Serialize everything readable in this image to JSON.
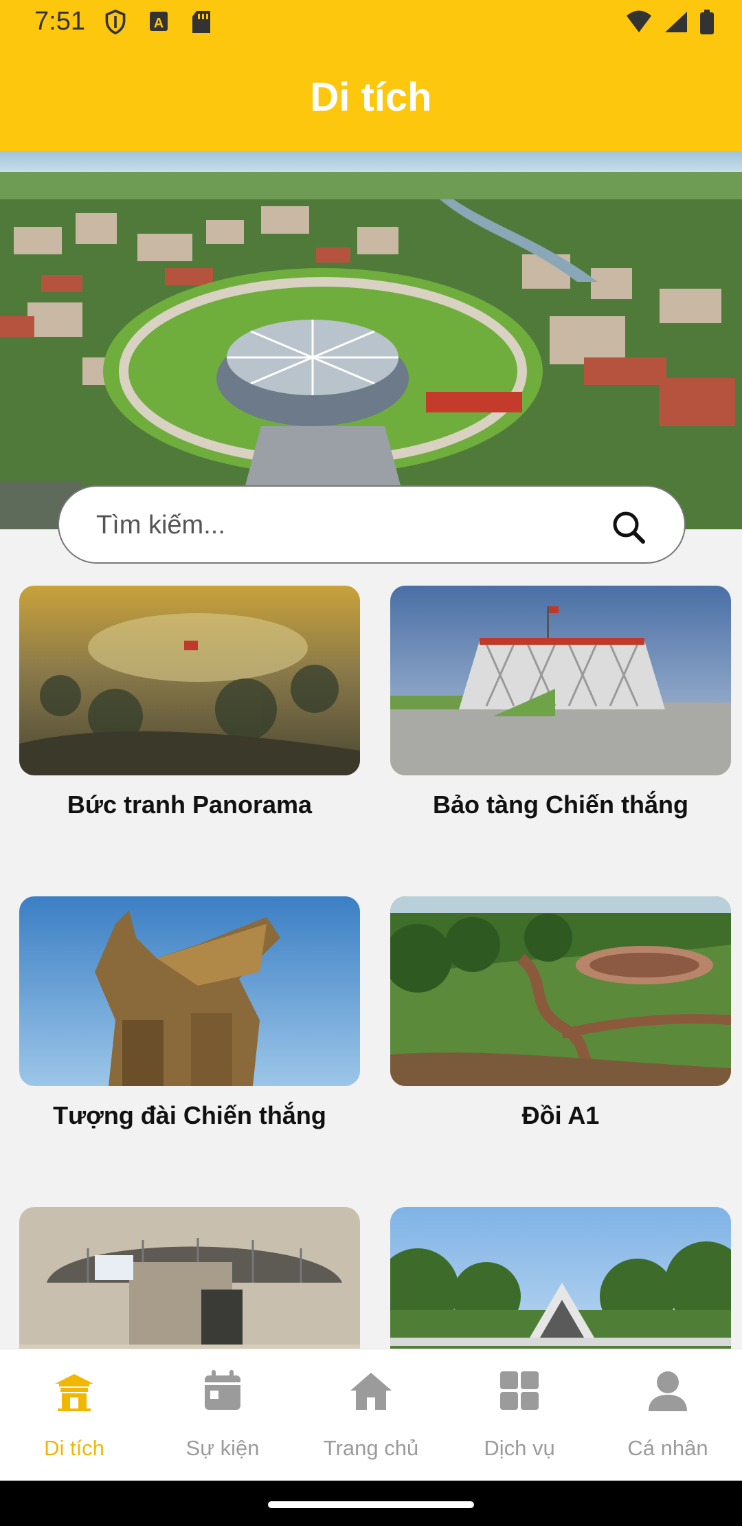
{
  "status_bar": {
    "time": "7:51",
    "left_icons": [
      "shield-icon",
      "a-badge-icon",
      "sd-card-icon"
    ],
    "right_icons": [
      "wifi-icon",
      "signal-icon",
      "battery-icon"
    ]
  },
  "app_bar": {
    "title": "Di tích",
    "background": "#FDC70E"
  },
  "search": {
    "placeholder": "Tìm kiếm...",
    "icon": "search-icon"
  },
  "sites": [
    {
      "name": "Bức tranh Panorama",
      "image": "panorama-painting"
    },
    {
      "name": "Bảo tàng Chiến thắng",
      "image": "victory-museum"
    },
    {
      "name": "Tượng đài Chiến thắng",
      "image": "victory-monument"
    },
    {
      "name": "Đồi A1",
      "image": "a1-hill"
    },
    {
      "name": "",
      "image": "bunker"
    },
    {
      "name": "",
      "image": "memorial"
    }
  ],
  "bottom_nav": {
    "items": [
      {
        "label": "Di tích",
        "icon": "temple-icon",
        "active": true
      },
      {
        "label": "Sự kiện",
        "icon": "calendar-icon",
        "active": false
      },
      {
        "label": "Trang chủ",
        "icon": "home-icon",
        "active": false
      },
      {
        "label": "Dịch vụ",
        "icon": "grid-icon",
        "active": false
      },
      {
        "label": "Cá nhân",
        "icon": "person-icon",
        "active": false
      }
    ],
    "active_color": "#F2B705",
    "inactive_color": "#9b9b9b"
  }
}
